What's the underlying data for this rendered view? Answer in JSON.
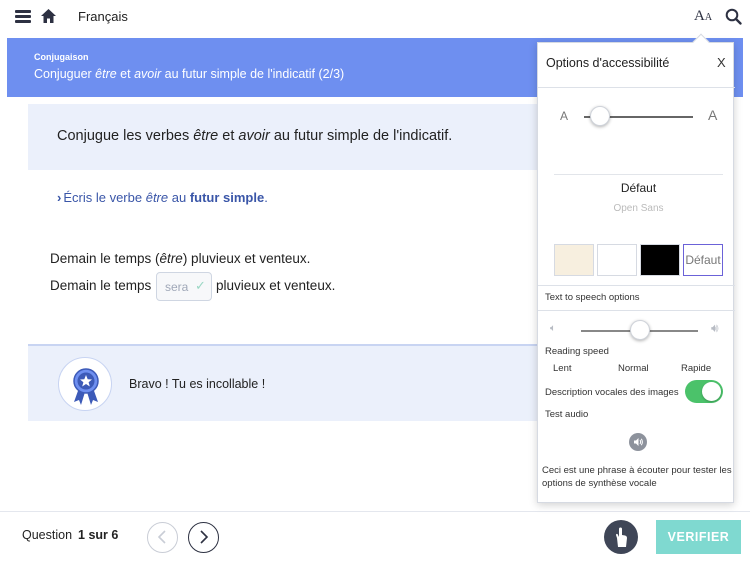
{
  "header": {
    "title": "Français",
    "font_icon_label": "A",
    "font_icon_small": "A"
  },
  "banner": {
    "category": "Conjugaison",
    "title_parts": [
      "Conjuguer ",
      "être",
      " et ",
      "avoir",
      " au futur simple de l'indicatif (2/3)"
    ]
  },
  "instruction": {
    "parts": [
      "Conjugue les verbes ",
      "être",
      " et ",
      "avoir",
      " au futur simple de l'indicatif."
    ]
  },
  "hint": {
    "chevron": "›",
    "parts": [
      "Écris le verbe ",
      "être",
      " au ",
      "futur simple",
      "."
    ]
  },
  "exercise": {
    "sentence1_parts": [
      "Demain le temps (",
      "être",
      ") pluvieux et venteux."
    ],
    "sentence2_before": "Demain le temps",
    "answer_value": "sera",
    "answer_check": "✓",
    "sentence2_after": "pluvieux et venteux."
  },
  "result": {
    "message": "Bravo ! Tu es incollable !"
  },
  "footer": {
    "question_label": "Question",
    "question_progress": "1 sur 6",
    "verify_label": "VERIFIER"
  },
  "accessibility_panel": {
    "title": "Options d'accessibilité",
    "close_label": "X",
    "size_small": "A",
    "size_large": "A",
    "font_size_level": 0.15,
    "font_selected": "Défaut",
    "font_option": "Open Sans",
    "themes": [
      {
        "color": "#f7efdf",
        "label": ""
      },
      {
        "color": "#ffffff",
        "label": ""
      },
      {
        "color": "#000000",
        "label": ""
      },
      {
        "color": "#ffffff",
        "label": "Défaut"
      }
    ],
    "tts_title": "Text to speech options",
    "volume_level": 0.5,
    "reading_speed_label": "Reading speed",
    "speed_options": [
      "Lent",
      "Normal",
      "Rapide"
    ],
    "image_description_label": "Description vocales des images",
    "image_description_enabled": true,
    "test_audio_label": "Test audio",
    "test_text": "Ceci est une phrase à écouter pour tester les options de synthèse vocale"
  },
  "colors": {
    "banner": "#6e8ff0",
    "panel_bg": "#ebf0fb",
    "hint": "#3a56a8",
    "toggle_on": "#4bc26a",
    "verify": "#7fd9d0"
  }
}
